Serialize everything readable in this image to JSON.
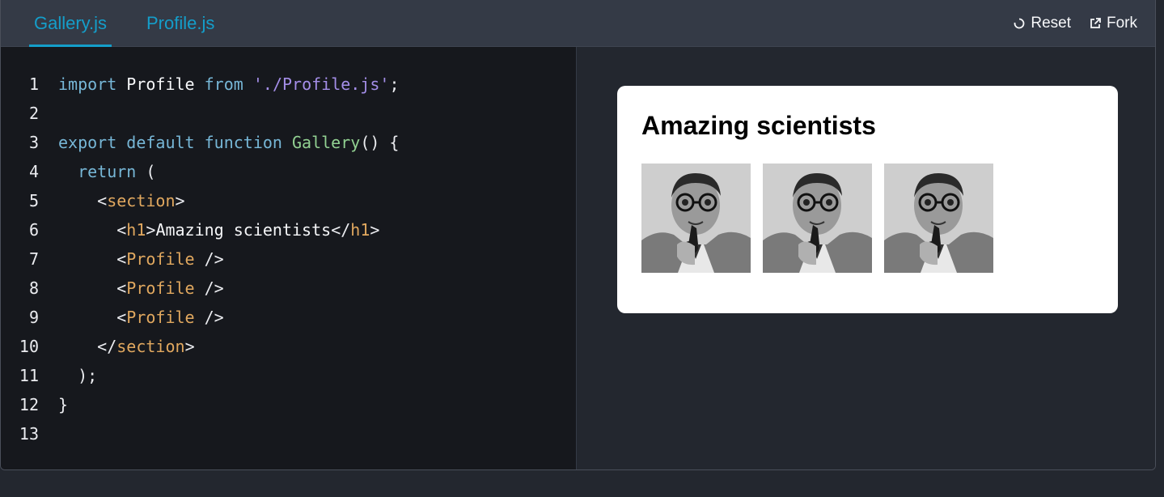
{
  "tabs": {
    "gallery": "Gallery.js",
    "profile": "Profile.js"
  },
  "actions": {
    "reset": "Reset",
    "fork": "Fork"
  },
  "code": {
    "line_numbers": [
      "1",
      "2",
      "3",
      "4",
      "5",
      "6",
      "7",
      "8",
      "9",
      "10",
      "11",
      "12",
      "13"
    ],
    "t": {
      "import": "import",
      "Profile": "Profile",
      "from": "from",
      "path": "'./Profile.js'",
      "semi": ";",
      "export": "export",
      "default": "default",
      "function": "function",
      "Gallery": "Gallery",
      "parens_brace": "() {",
      "return": "return",
      "open_paren": "(",
      "lt": "<",
      "gt": ">",
      "close_lt": "</",
      "self_close": " />",
      "section": "section",
      "h1": "h1",
      "h1_text": "Amazing scientists",
      "close_paren_semi": ");",
      "close_brace": "}"
    }
  },
  "preview": {
    "heading": "Amazing scientists",
    "photos": [
      {
        "alt": "scientist-portrait"
      },
      {
        "alt": "scientist-portrait"
      },
      {
        "alt": "scientist-portrait"
      }
    ]
  },
  "colors": {
    "accent": "#149eca",
    "keyword": "#77b7d7",
    "string": "#a48ee8",
    "function": "#92d192",
    "tag": "#e1a85f"
  }
}
